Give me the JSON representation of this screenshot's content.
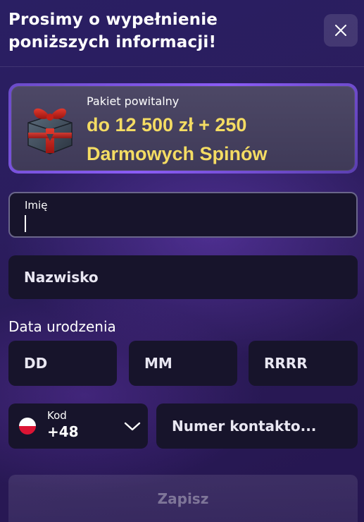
{
  "header": {
    "title_line1": "Prosimy o wypełnienie",
    "title_line2": "poniższych informacji!",
    "close_icon": "close-icon"
  },
  "promo": {
    "label": "Pakiet powitalny",
    "amount_line1": "do 12 500 zł + 250",
    "amount_line2": "Darmowych Spinów",
    "icon": "gift-icon",
    "amount_color": "#f4dc63"
  },
  "form": {
    "first_name_label": "Imię",
    "first_name_value": "",
    "last_name_placeholder": "Nazwisko",
    "birth_label": "Data urodzenia",
    "day_placeholder": "DD",
    "month_placeholder": "MM",
    "year_placeholder": "RRRR",
    "country_code_label": "Kod",
    "country_code_value": "+48",
    "country_flag": "poland-flag-icon",
    "phone_placeholder": "Numer kontakto..."
  },
  "actions": {
    "save_label": "Zapisz"
  }
}
